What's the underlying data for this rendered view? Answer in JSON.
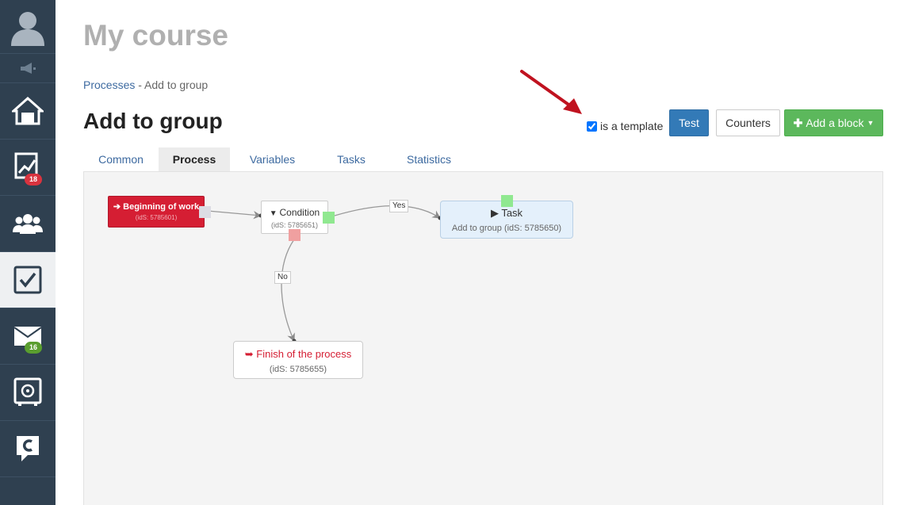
{
  "sidebar": {
    "items": [
      {
        "icon": "user-avatar-icon"
      },
      {
        "icon": "megaphone-icon"
      },
      {
        "icon": "home-icon"
      },
      {
        "icon": "chart-icon",
        "badge": "18"
      },
      {
        "icon": "users-icon"
      },
      {
        "icon": "checkbox-icon"
      },
      {
        "icon": "mail-icon",
        "badge": "16"
      },
      {
        "icon": "safe-icon"
      },
      {
        "icon": "chat-icon"
      }
    ]
  },
  "header": {
    "course_title": "My course",
    "breadcrumb": {
      "link": "Processes",
      "separator": " - ",
      "current": "Add to group"
    },
    "page_title": "Add to group",
    "template_label": "is a template",
    "template_checked": true
  },
  "toolbar": {
    "test_label": "Test",
    "counters_label": "Counters",
    "add_block_label": "Add a block"
  },
  "tabs": [
    {
      "label": "Common"
    },
    {
      "label": "Process",
      "active": true
    },
    {
      "label": "Variables"
    },
    {
      "label": "Tasks"
    },
    {
      "label": "Statistics"
    }
  ],
  "flow": {
    "start": {
      "title": "Beginning of work",
      "id": "(idS: 5785601)"
    },
    "condition": {
      "title": "Condition",
      "id": "(idS: 5785651)"
    },
    "task": {
      "title": "Task",
      "subtitle": "Add to group (idS: 5785650)"
    },
    "finish": {
      "title": "Finish of the process",
      "id": "(idS: 5785655)"
    },
    "edge_yes": "Yes",
    "edge_no": "No"
  },
  "colors": {
    "sidebar_bg": "#2f4050",
    "primary": "#337ab7",
    "success": "#5cb85c",
    "danger": "#d51e33",
    "port_green": "#90e890",
    "port_red": "#f0a0a0"
  }
}
